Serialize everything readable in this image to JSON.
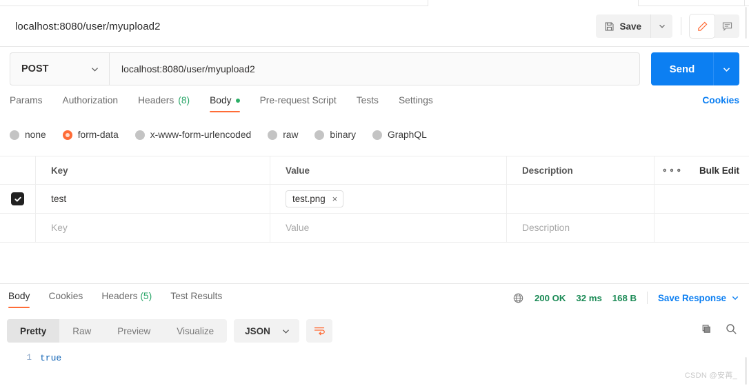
{
  "window": {
    "request_title": "localhost:8080/user/myupload2"
  },
  "titlebar": {
    "save_label": "Save",
    "save_caret_icon": "chevron-down-icon",
    "save_icon": "floppy-disk-icon",
    "edit_icon": "pencil-icon",
    "comment_icon": "comment-icon"
  },
  "url_row": {
    "method": "POST",
    "method_caret_icon": "chevron-down-icon",
    "url": "localhost:8080/user/myupload2",
    "send_label": "Send",
    "send_caret_icon": "chevron-down-icon"
  },
  "request_tabs": {
    "items": [
      {
        "label": "Params",
        "active": false
      },
      {
        "label": "Authorization",
        "active": false
      },
      {
        "label": "Headers",
        "count": "(8)",
        "active": false
      },
      {
        "label": "Body",
        "active": true,
        "dot": true
      },
      {
        "label": "Pre-request Script",
        "active": false
      },
      {
        "label": "Tests",
        "active": false
      },
      {
        "label": "Settings",
        "active": false
      }
    ],
    "cookies_label": "Cookies"
  },
  "body_types": {
    "options": [
      {
        "label": "none",
        "selected": false
      },
      {
        "label": "form-data",
        "selected": true
      },
      {
        "label": "x-www-form-urlencoded",
        "selected": false
      },
      {
        "label": "raw",
        "selected": false
      },
      {
        "label": "binary",
        "selected": false
      },
      {
        "label": "GraphQL",
        "selected": false
      }
    ]
  },
  "kv_table": {
    "headers": {
      "key": "Key",
      "value": "Value",
      "description": "Description",
      "more_icon": "ellipsis-icon",
      "bulk_edit": "Bulk Edit"
    },
    "rows": [
      {
        "checked": true,
        "key": "test",
        "value_chip": "test.png",
        "value_chip_remove": "×",
        "description": ""
      }
    ],
    "placeholder_row": {
      "key": "Key",
      "value": "Value",
      "description": "Description"
    }
  },
  "response": {
    "tabs": [
      {
        "label": "Body",
        "active": true
      },
      {
        "label": "Cookies",
        "active": false
      },
      {
        "label": "Headers",
        "count": "(5)",
        "active": false
      },
      {
        "label": "Test Results",
        "active": false
      }
    ],
    "globe_icon": "globe-icon",
    "status": "200 OK",
    "time": "32 ms",
    "size": "168 B",
    "save_response_label": "Save Response",
    "save_response_caret_icon": "chevron-down-icon",
    "view_modes": [
      {
        "label": "Pretty",
        "active": true
      },
      {
        "label": "Raw",
        "active": false
      },
      {
        "label": "Preview",
        "active": false
      },
      {
        "label": "Visualize",
        "active": false
      }
    ],
    "language": "JSON",
    "language_caret_icon": "chevron-down-icon",
    "wrap_icon": "wrap-text-icon",
    "copy_icon": "copy-icon",
    "search_icon": "search-icon",
    "body_lines": [
      {
        "number": "1",
        "text": "true"
      }
    ]
  },
  "watermark": "CSDN @安苒_",
  "colors": {
    "accent_orange": "#ff6c37",
    "primary_blue": "#0c7ff2",
    "status_green": "#1a8a55",
    "link_blue": "#0c7ff2"
  }
}
